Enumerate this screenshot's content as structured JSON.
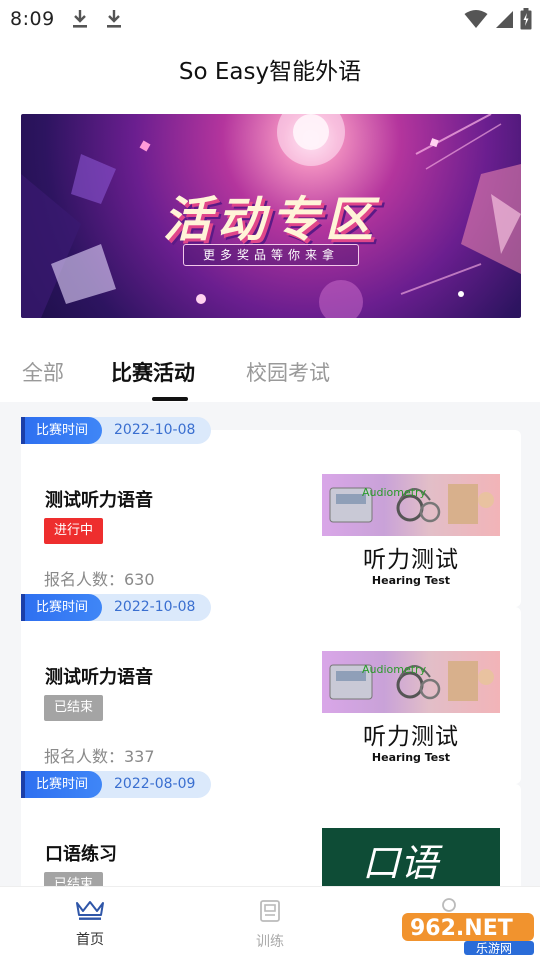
{
  "status_bar": {
    "time": "8:09"
  },
  "app": {
    "title": "So Easy智能外语"
  },
  "banner": {
    "title": "活动专区",
    "subtitle": "更多奖品等你来拿"
  },
  "tabs": [
    {
      "label": "全部",
      "active": false
    },
    {
      "label": "比赛活动",
      "active": true
    },
    {
      "label": "校园考试",
      "active": false
    }
  ],
  "cards": [
    {
      "tag_label": "比赛时间",
      "date": "2022-10-08",
      "title": "测试听力语音",
      "status": "进行中",
      "count": "报名人数：630",
      "thumb_caption": "听力测试",
      "thumb_sub": "Hearing Test",
      "thumb_overlay": "Audiometry"
    },
    {
      "tag_label": "比赛时间",
      "date": "2022-10-08",
      "title": "测试听力语音",
      "status": "已结束",
      "count": "报名人数：337",
      "thumb_caption": "听力测试",
      "thumb_sub": "Hearing Test",
      "thumb_overlay": "Audiometry"
    },
    {
      "tag_label": "比赛时间",
      "date": "2022-08-09",
      "title": "口语练习",
      "status": "已结束",
      "thumb_caption": "口语"
    }
  ],
  "bottom_nav": [
    {
      "label": "首页",
      "icon": "crown-icon",
      "active": true
    },
    {
      "label": "训练",
      "icon": "clipboard-icon",
      "active": false
    }
  ],
  "watermark": {
    "text": "962.NET",
    "sub": "乐游网"
  },
  "colors": {
    "accent_blue": "#2e6ff0",
    "running_red": "#ee2e2e",
    "ended_gray": "#a4a4a4"
  }
}
